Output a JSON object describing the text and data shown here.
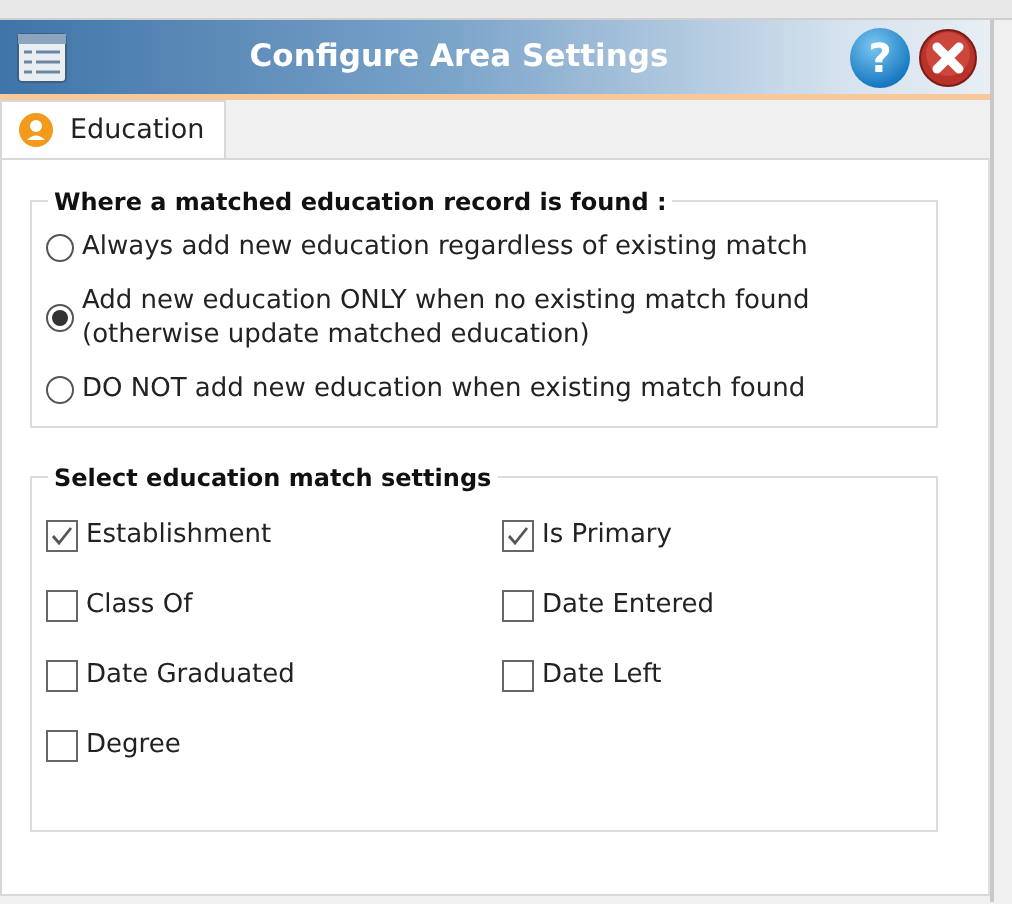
{
  "window": {
    "title": "Configure Area Settings",
    "help_button": "?"
  },
  "tabs": [
    {
      "label": "Education",
      "selected": true
    }
  ],
  "match_record_group": {
    "title": "Where a matched education record is found :",
    "options": [
      {
        "label": "Always add new education regardless of existing match",
        "selected": false
      },
      {
        "label": "Add new education ONLY when no existing match found\n(otherwise update matched education)",
        "selected": true
      },
      {
        "label": "DO NOT add new education when existing match found",
        "selected": false
      }
    ]
  },
  "match_settings_group": {
    "title": "Select education match settings",
    "fields": [
      {
        "label": "Establishment",
        "checked": true
      },
      {
        "label": "Is Primary",
        "checked": true
      },
      {
        "label": "Class Of",
        "checked": false
      },
      {
        "label": "Date Entered",
        "checked": false
      },
      {
        "label": "Date Graduated",
        "checked": false
      },
      {
        "label": "Date Left",
        "checked": false
      },
      {
        "label": "Degree",
        "checked": false
      }
    ]
  }
}
